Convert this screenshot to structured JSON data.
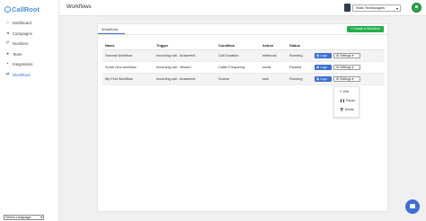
{
  "brand": {
    "name": "CallRoot"
  },
  "sidebar": {
    "items": [
      {
        "label": "Dashboard",
        "icon": "home-icon"
      },
      {
        "label": "Campaigns",
        "icon": "megaphone-icon"
      },
      {
        "label": "Numbers",
        "icon": "hash-icon"
      },
      {
        "label": "Team",
        "icon": "team-icon"
      },
      {
        "label": "Integrations",
        "icon": "plug-icon"
      },
      {
        "label": "Workflows",
        "icon": "workflow-icon"
      }
    ],
    "active": "Workflows",
    "language": "Select Language"
  },
  "topbar": {
    "title": "Workflows",
    "org": "Stato Technologies"
  },
  "tabs": {
    "workflows": "Workflows"
  },
  "actions": {
    "create": "+ Create a Workflow"
  },
  "table": {
    "headers": [
      "Name",
      "Trigger",
      "Condition",
      "Action",
      "Status"
    ],
    "rows": [
      {
        "name": "Second Workflow",
        "trigger": "Incoming call - Answered",
        "condition": "Call Duration",
        "action": "webhook",
        "status": "Running"
      },
      {
        "name": "Some new workflow",
        "trigger": "Incoming call - Missed",
        "condition": "Caller Frequency",
        "action": "email",
        "status": "Paused"
      },
      {
        "name": "My First Workflow",
        "trigger": "Incoming call - Answered",
        "condition": "Source",
        "action": "sms",
        "status": "Running"
      }
    ],
    "logs_label": "Logs",
    "settings_label": "Settings"
  },
  "menu": {
    "items": [
      "Edit",
      "Pause",
      "Delete"
    ]
  },
  "colors": {
    "accent": "#3b6fd4",
    "create": "#21b04b"
  }
}
